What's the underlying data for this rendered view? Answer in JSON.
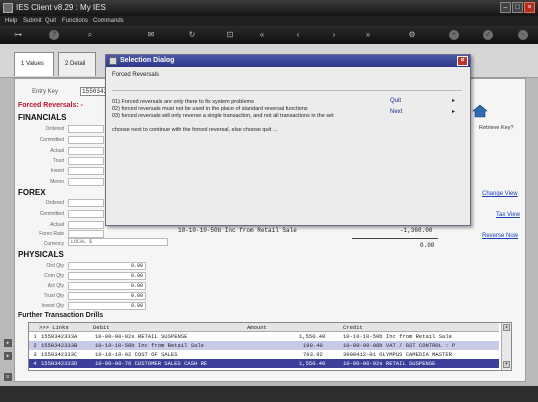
{
  "window": {
    "title": "IES Client v8.29 : My IES"
  },
  "menu": [
    "Help",
    "Submit",
    "Quit",
    "Functions",
    "Commands"
  ],
  "tabs": [
    {
      "label": "1 Values",
      "active": true
    },
    {
      "label": "2 Detail",
      "active": false
    }
  ],
  "entry_key": {
    "label": "Entry Key",
    "value": "1550342333"
  },
  "section_forced": "Forced Reversals: -",
  "financials": {
    "title": "FINANCIALS",
    "rows": [
      "Ordered",
      "Committed",
      "Actual",
      "Trust",
      "Invest",
      "Memo"
    ]
  },
  "forex": {
    "title": "FOREX",
    "rows": [
      "Ordered",
      "Committed",
      "Actual",
      "Forex Rate",
      "Currency"
    ],
    "currency_value": "LOCAL $"
  },
  "physicals": {
    "title": "PHYSICALS",
    "rows": [
      {
        "label": "Ord Qty",
        "value": "0.00"
      },
      {
        "label": "Com Qty",
        "value": "0.00"
      },
      {
        "label": "Act Qty",
        "value": "0.00"
      },
      {
        "label": "Trust Qty",
        "value": "0.00"
      },
      {
        "label": "Invest Qty",
        "value": "0.00"
      }
    ]
  },
  "side": {
    "retrieve_key": "Retrieve Key?",
    "change_view": "Change View",
    "tax_view": "Tax View",
    "reverse_now": "Reverse Now"
  },
  "ledger": {
    "line": "10-10-10-50b Inc from Retail Sale",
    "amount": "-1,360.00",
    "total": "0.00"
  },
  "drills": {
    "title": "Further Transaction Drills",
    "headers": {
      "links": ">>> Links",
      "debit": "Debit",
      "amount": "Amount",
      "credit": "Credit"
    },
    "rows": [
      {
        "num": "1",
        "link": "1550342333A",
        "debit": "10-00-00-02s RETAIL SUSPENSE",
        "amount": "1,550.40",
        "credit": "10-10-10-50b Inc from Retail Sale"
      },
      {
        "num": "2",
        "link": "1550342333B",
        "debit": "10-10-10-50b Inc from Retail Sale",
        "amount": "190.40",
        "credit": "10-00-00-08b VAT / GST CONTROL : P"
      },
      {
        "num": "3",
        "link": "1550342333C",
        "debit": "10-10-10-02 COST OF SALES",
        "amount": "703.92",
        "credit": "3008412-01 OLYMPUS CAMEDIA MASTER"
      },
      {
        "num": "4",
        "link": "1550342333D",
        "debit": "10-00-00-76 CUSTOMER SALES CASH RE",
        "amount": "1,550.40",
        "credit": "10-00-00-02s RETAIL SUSPENSE"
      }
    ]
  },
  "dialog": {
    "title": "Selection Dialog",
    "heading": "Forced Reversals",
    "lines": [
      "01) Forced reversals are only there to fix system problems",
      "02) forced reversals must not be used in the place of standard reversal functions",
      "03) forced reversals will only reverse a single transaction, and not all transactions in the set"
    ],
    "prompt": "choose next to continue with the forced reversal, else choose quit ...",
    "commands": [
      "Quit",
      "Next"
    ]
  },
  "colors": {
    "accent_red": "#c0102a",
    "link_blue": "#1a3fb8",
    "dialog_title": "#2d3988",
    "selected_row": "#3b3f9a"
  }
}
